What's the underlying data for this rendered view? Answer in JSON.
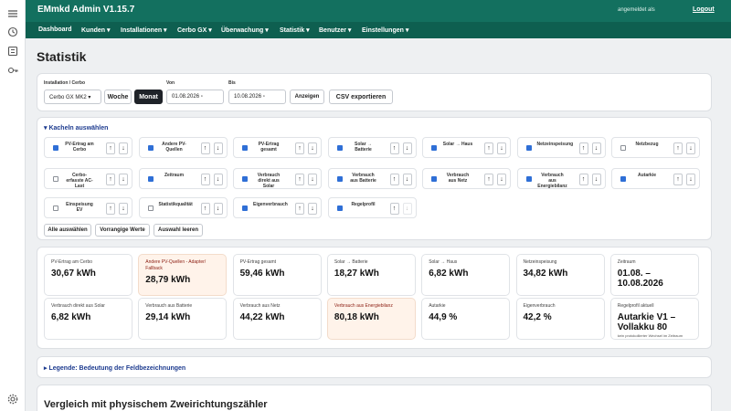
{
  "app": {
    "title": "EMmkd Admin V1.15.7",
    "signed_in": "angemeldet als",
    "logout": "Logout"
  },
  "nav": [
    {
      "label": "Dashboard"
    },
    {
      "label": "Kunden ▾"
    },
    {
      "label": "Installationen ▾"
    },
    {
      "label": "Cerbo GX ▾"
    },
    {
      "label": "Überwachung ▾"
    },
    {
      "label": "Statistik ▾"
    },
    {
      "label": "Benutzer ▾"
    },
    {
      "label": "Einstellungen ▾"
    }
  ],
  "rail": [
    "menu-icon",
    "history-icon",
    "list-icon",
    "key-icon",
    "settings-icon"
  ],
  "page": {
    "title": "Statistik"
  },
  "filters": {
    "installation_label": "Installation / Cerbo",
    "installation_value": "Cerbo GX MK2 ▾",
    "week": "Woche",
    "month": "Monat",
    "von_label": "Von",
    "von_value": "01.08.2026",
    "bis_label": "Bis",
    "bis_value": "10.08.2026",
    "show": "Anzeigen",
    "export": "CSV exportieren"
  },
  "kacheln": {
    "title": "▾ Kacheln auswählen",
    "select_all": "Alle auswählen",
    "priority": "Vorrangige Werte",
    "clear": "Auswahl leeren",
    "items": [
      {
        "label": "PV-Ertrag am Cerbo",
        "checked": true
      },
      {
        "label": "Andere PV-Quellen",
        "checked": true
      },
      {
        "label": "PV-Ertrag gesamt",
        "checked": true
      },
      {
        "label": "Solar → Batterie",
        "checked": true
      },
      {
        "label": "Solar → Haus",
        "checked": true
      },
      {
        "label": "Netzeinspeisung",
        "checked": true
      },
      {
        "label": "Netzbezug",
        "checked": false
      },
      {
        "label": "Cerbo-erfasste AC-Last",
        "checked": false
      },
      {
        "label": "Zeitraum",
        "checked": true
      },
      {
        "label": "Verbrauch direkt aus Solar",
        "checked": true
      },
      {
        "label": "Verbrauch aus Batterie",
        "checked": true
      },
      {
        "label": "Verbrauch aus Netz",
        "checked": true
      },
      {
        "label": "Verbrauch aus Energiebilanz",
        "checked": true
      },
      {
        "label": "Autarkie",
        "checked": true
      },
      {
        "label": "Einspeisung EV",
        "checked": false
      },
      {
        "label": "Statistikqualität",
        "checked": false
      },
      {
        "label": "Eigenverbrauch",
        "checked": true
      },
      {
        "label": "Regelprofil",
        "checked": true
      }
    ]
  },
  "stats": [
    {
      "label": "PV-Ertrag am Cerbo",
      "value": "30,67 kWh",
      "warn": false
    },
    {
      "label": "Andere PV-Quellen - Adapter/\nFallback",
      "value": "28,79 kWh",
      "warn": true
    },
    {
      "label": "PV-Ertrag gesamt",
      "value": "59,46 kWh",
      "warn": false
    },
    {
      "label": "Solar → Batterie",
      "value": "18,27 kWh",
      "warn": false
    },
    {
      "label": "Solar → Haus",
      "value": "6,82 kWh",
      "warn": false
    },
    {
      "label": "Netzeinspeisung",
      "value": "34,82 kWh",
      "warn": false
    },
    {
      "label": "Zeitraum",
      "value": "01.08. –\n10.08.2026",
      "warn": false
    },
    {
      "label": "Verbrauch direkt aus Solar",
      "value": "6,82 kWh",
      "warn": false
    },
    {
      "label": "Verbrauch aus Batterie",
      "value": "29,14 kWh",
      "warn": false
    },
    {
      "label": "Verbrauch aus Netz",
      "value": "44,22 kWh",
      "warn": false
    },
    {
      "label": "Verbrauch aus Energiebilanz",
      "value": "80,18 kWh",
      "warn": true
    },
    {
      "label": "Autarkie",
      "value": "44,9 %",
      "warn": false
    },
    {
      "label": "Eigenverbrauch",
      "value": "42,2 %",
      "warn": false
    },
    {
      "label": "Regelprofil aktuell",
      "value": "Autarkie V1 –\nVollakku 80",
      "note": "kein protokollierter Wechsel im Zeitraum",
      "warn": false
    }
  ],
  "legend": {
    "title": "▸ Legende: Bedeutung der Feldbezeichnungen"
  },
  "compare": {
    "title": "Vergleich mit physischem Zweirichtungszähler"
  }
}
